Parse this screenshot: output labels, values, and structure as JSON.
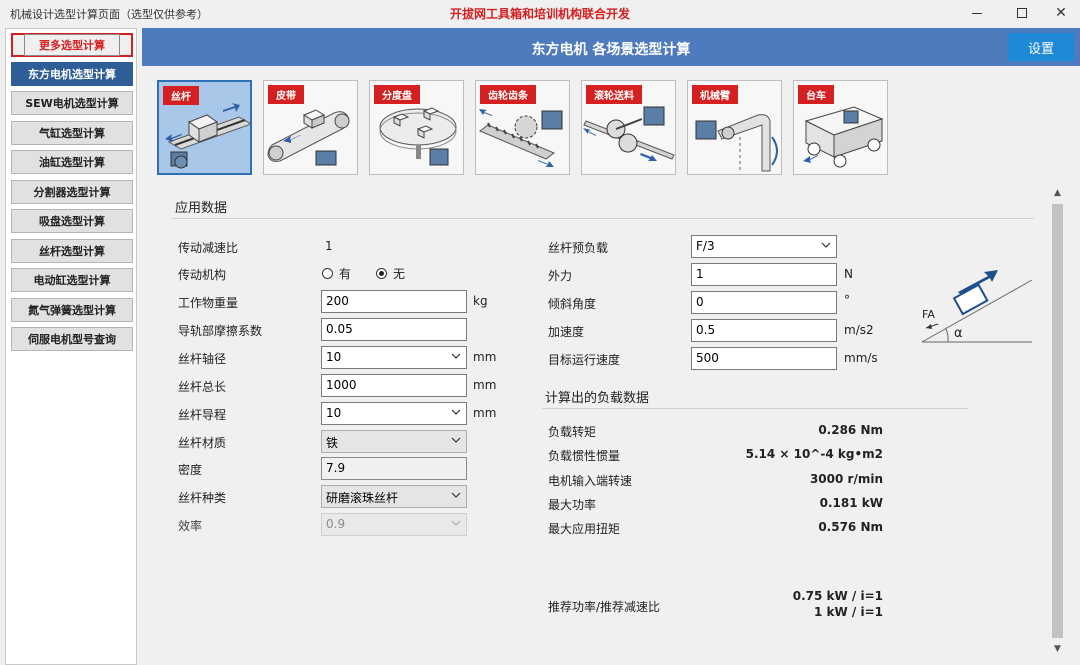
{
  "window": {
    "app_title": "机械设计选型计算页面（选型仅供参考）",
    "center_title": "开拔网工具箱和培训机构联合开发"
  },
  "sidebar": {
    "more_label": "更多选型计算",
    "items": [
      {
        "label": "东方电机选型计算",
        "active": true
      },
      {
        "label": "SEW电机选型计算"
      },
      {
        "label": "气缸选型计算"
      },
      {
        "label": "油缸选型计算"
      },
      {
        "label": "分割器选型计算"
      },
      {
        "label": "吸盘选型计算"
      },
      {
        "label": "丝杆选型计算"
      },
      {
        "label": "电动缸选型计算"
      },
      {
        "label": "氮气弹簧选型计算"
      },
      {
        "label": "伺服电机型号查询"
      }
    ]
  },
  "header": {
    "title": "东方电机 各场景选型计算",
    "settings_label": "设置"
  },
  "scenarios": [
    {
      "label": "丝杆",
      "icon": "ball-screw-icon",
      "active": true
    },
    {
      "label": "皮带",
      "icon": "belt-conveyor-icon"
    },
    {
      "label": "分度盘",
      "icon": "index-table-icon"
    },
    {
      "label": "齿轮齿条",
      "icon": "rack-pinion-icon"
    },
    {
      "label": "滚轮送料",
      "icon": "roller-feed-icon"
    },
    {
      "label": "机械臂",
      "icon": "robot-arm-icon"
    },
    {
      "label": "台车",
      "icon": "cart-icon"
    }
  ],
  "application": {
    "section_title": "应用数据",
    "gear_ratio": {
      "label": "传动减速比",
      "value": "1"
    },
    "transmission": {
      "label": "传动机构",
      "option_yes": "有",
      "option_no": "无",
      "selected": "无"
    },
    "workpiece_weight": {
      "label": "工作物重量",
      "value": "200",
      "unit": "kg"
    },
    "friction": {
      "label": "导轨部摩擦系数",
      "value": "0.05"
    },
    "screw_diameter": {
      "label": "丝杆轴径",
      "value": "10",
      "unit": "mm"
    },
    "screw_length": {
      "label": "丝杆总长",
      "value": "1000",
      "unit": "mm"
    },
    "screw_lead": {
      "label": "丝杆导程",
      "value": "10",
      "unit": "mm"
    },
    "screw_material": {
      "label": "丝杆材质",
      "value": "铁"
    },
    "density": {
      "label": "密度",
      "value": "7.9"
    },
    "screw_type": {
      "label": "丝杆种类",
      "value": "研磨滚珠丝杆"
    },
    "efficiency": {
      "label": "效率",
      "value": "0.9"
    },
    "preload": {
      "label": "丝杆预负载",
      "value": "F/3"
    },
    "external_force": {
      "label": "外力",
      "value": "1",
      "unit": "N"
    },
    "incline_angle": {
      "label": "倾斜角度",
      "value": "0",
      "unit": "°"
    },
    "acceleration": {
      "label": "加速度",
      "value": "0.5",
      "unit": "m/s2"
    },
    "target_speed": {
      "label": "目标运行速度",
      "value": "500",
      "unit": "mm/s"
    },
    "diagram_force_label": "FA",
    "diagram_angle_label": "α"
  },
  "results": {
    "section_title": "计算出的负载数据",
    "load_torque": {
      "label": "负载转矩",
      "value": "0.286 Nm"
    },
    "load_inertia": {
      "label": "负载惯性惯量",
      "value": "5.14 × 10^-4 kg•m2"
    },
    "input_speed": {
      "label": "电机输入端转速",
      "value": "3000 r/min"
    },
    "max_power": {
      "label": "最大功率",
      "value": "0.181 kW"
    },
    "max_torque": {
      "label": "最大应用扭矩",
      "value": "0.576 Nm"
    },
    "recommend": {
      "label": "推荐功率/推荐减速比",
      "line1": "0.75 kW / i=1",
      "line2": "1 kW / i=1"
    }
  }
}
